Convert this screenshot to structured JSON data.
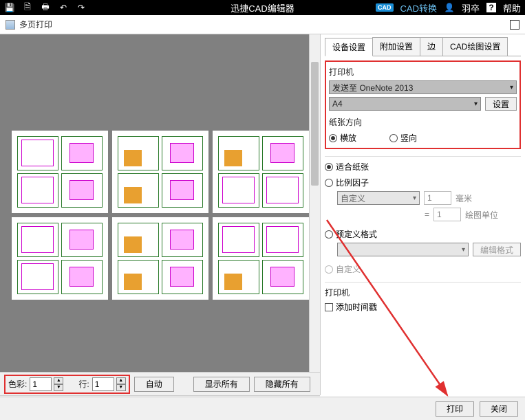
{
  "topbar": {
    "title": "迅捷CAD编辑器",
    "convert": "CAD转换",
    "user": "羽卒",
    "help": "帮助"
  },
  "dialog": {
    "title": "多页打印"
  },
  "tabs": {
    "t1": "设备设置",
    "t2": "附加设置",
    "t3": "边",
    "t4": "CAD绘图设置"
  },
  "printer": {
    "label": "打印机",
    "device": "发送至 OneNote 2013",
    "paper": "A4",
    "config": "设置"
  },
  "orient": {
    "label": "纸张方向",
    "h": "横放",
    "v": "竖向"
  },
  "scale": {
    "fit": "适合纸张",
    "factor": "比例因子",
    "custom": "自定义",
    "one": "1",
    "mm": "毫米",
    "eq": "=",
    "one2": "1",
    "unit": "绘图单位",
    "predef": "预定义格式",
    "editfmt": "编辑格式",
    "customr": "自定义"
  },
  "printer2": {
    "label": "打印机",
    "timestamp": "添加时间戳"
  },
  "footer": {
    "color": "色彩:",
    "colval": "1",
    "row": "行:",
    "rowval": "1",
    "auto": "自动",
    "showall": "显示所有",
    "hideall": "隐藏所有",
    "print": "打印",
    "close": "关闭"
  }
}
